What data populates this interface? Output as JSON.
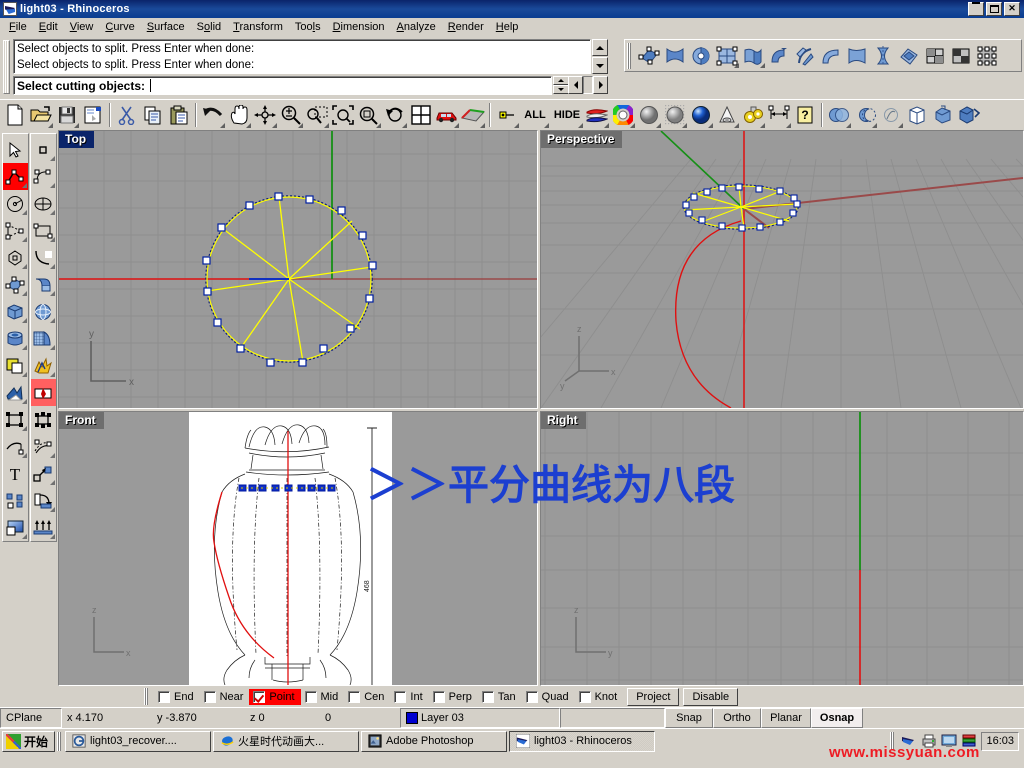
{
  "window": {
    "title": "light03 - Rhinoceros",
    "icon": "rhino-icon",
    "buttons": {
      "minimize": "_",
      "maximize": "❐",
      "close": "✕"
    }
  },
  "menu": {
    "items": [
      {
        "label": "File",
        "accel": "F"
      },
      {
        "label": "Edit",
        "accel": "E"
      },
      {
        "label": "View",
        "accel": "V"
      },
      {
        "label": "Curve",
        "accel": "C"
      },
      {
        "label": "Surface",
        "accel": "S"
      },
      {
        "label": "Solid",
        "accel": "o"
      },
      {
        "label": "Transform",
        "accel": "T"
      },
      {
        "label": "Tools",
        "accel": "l"
      },
      {
        "label": "Dimension",
        "accel": "D"
      },
      {
        "label": "Analyze",
        "accel": "A"
      },
      {
        "label": "Render",
        "accel": "R"
      },
      {
        "label": "Help",
        "accel": "H"
      }
    ]
  },
  "command": {
    "history": [
      "Select objects to split. Press Enter when done:",
      "Select objects to split. Press Enter when done:"
    ],
    "prompt_label": "Select cutting objects",
    "prompt_value": "",
    "prompt_placeholder": ""
  },
  "toolbars": {
    "standard": [
      {
        "name": "new-file-icon",
        "title": "New"
      },
      {
        "name": "open-file-icon",
        "title": "Open"
      },
      {
        "name": "save-icon",
        "title": "Save"
      },
      {
        "name": "print-icon",
        "title": "Print"
      },
      {
        "name": "cut-icon",
        "title": "Cut"
      },
      {
        "name": "copy-icon",
        "title": "Copy"
      },
      {
        "name": "paste-icon",
        "title": "Paste"
      },
      {
        "name": "undo-icon",
        "title": "Undo"
      },
      {
        "name": "pan-hand-icon",
        "title": "Pan"
      },
      {
        "name": "rotate-view-icon",
        "title": "Rotate view"
      },
      {
        "name": "zoom-in-out-icon",
        "title": "Zoom"
      },
      {
        "name": "zoom-window-icon",
        "title": "Zoom window"
      },
      {
        "name": "zoom-extents-icon",
        "title": "Zoom extents"
      },
      {
        "name": "zoom-selected-icon",
        "title": "Zoom selected"
      },
      {
        "name": "zoom-previous-icon",
        "title": "Zoom previous"
      },
      {
        "name": "four-view-icon",
        "title": "4 viewports"
      },
      {
        "name": "car-render-icon",
        "title": "Render"
      },
      {
        "name": "mesh-plane-icon",
        "title": "Shade"
      },
      {
        "name": "select-point-icon",
        "title": "Select"
      },
      {
        "name": "select-all-label",
        "title": "ALL",
        "text": "ALL"
      },
      {
        "name": "hide-label",
        "title": "HIDE",
        "text": "HIDE"
      },
      {
        "name": "layers-icon",
        "title": "Layers"
      },
      {
        "name": "color-wheel-icon",
        "title": "Color"
      },
      {
        "name": "shade-gray-icon",
        "title": "Shaded"
      },
      {
        "name": "render-mesh-icon",
        "title": "Render mesh"
      },
      {
        "name": "render-blue-icon",
        "title": "Render preview"
      },
      {
        "name": "spotlight-icon",
        "title": "Light"
      },
      {
        "name": "settings-gear-icon",
        "title": "Options"
      },
      {
        "name": "dimension-icon",
        "title": "Dimension"
      },
      {
        "name": "help-icon",
        "title": "Help"
      },
      {
        "name": "boolean-union-icon",
        "title": "Boolean union"
      },
      {
        "name": "boolean-difference-icon",
        "title": "Boolean difference"
      },
      {
        "name": "boolean-split-icon",
        "title": "Boolean split"
      },
      {
        "name": "cap-holes-icon",
        "title": "Cap holes"
      },
      {
        "name": "extrude-solid-icon",
        "title": "Extrude"
      },
      {
        "name": "box-edit-icon",
        "title": "Box edit"
      }
    ],
    "surface_tools": [
      {
        "name": "surface-from-points-icon",
        "title": "Surface from points"
      },
      {
        "name": "surface-from-curves-icon",
        "title": "Surface from curve network"
      },
      {
        "name": "revolve-surface-icon",
        "title": "Revolve"
      },
      {
        "name": "surface-grid-icon",
        "title": "Surface from grid"
      },
      {
        "name": "extrude-curve-icon",
        "title": "Extrude curve"
      },
      {
        "name": "sweep1-icon",
        "title": "Sweep 1 rail"
      },
      {
        "name": "sweep2-icon",
        "title": "Sweep 2 rails"
      },
      {
        "name": "loft-icon",
        "title": "Loft"
      },
      {
        "name": "rail-revolve-icon",
        "title": "Rail revolve"
      },
      {
        "name": "blend-surface-icon",
        "title": "Blend surface"
      },
      {
        "name": "patch-icon",
        "title": "Patch"
      },
      {
        "name": "surface-edit-1-icon",
        "title": "Surface edit"
      },
      {
        "name": "surface-edit-2-icon",
        "title": "Surface edit 2"
      },
      {
        "name": "control-points-icon",
        "title": "Control points"
      }
    ],
    "sidebar_left": [
      {
        "name": "select-arrow-icon",
        "title": "Select objects",
        "state": "normal"
      },
      {
        "name": "polyline-icon",
        "title": "Polyline",
        "state": "selected"
      },
      {
        "name": "circle-icon",
        "title": "Circle",
        "state": "normal"
      },
      {
        "name": "curve-point-icon",
        "title": "Curve from points",
        "state": "normal"
      },
      {
        "name": "polygon-icon",
        "title": "Polygon",
        "state": "normal"
      },
      {
        "name": "surface-patch-icon",
        "title": "Surface tools",
        "state": "normal"
      },
      {
        "name": "box-icon",
        "title": "Box",
        "state": "normal"
      },
      {
        "name": "cylinder-icon",
        "title": "Cylinder",
        "state": "normal"
      },
      {
        "name": "boolean-icon",
        "title": "Boolean",
        "state": "normal"
      },
      {
        "name": "fillet-edge-icon",
        "title": "Fillet edge",
        "state": "normal"
      },
      {
        "name": "group-objects-icon",
        "title": "Group",
        "state": "normal"
      },
      {
        "name": "offset-curve-icon",
        "title": "Offset curve",
        "state": "normal"
      },
      {
        "name": "text-tool-icon",
        "title": "Text",
        "state": "normal"
      },
      {
        "name": "points-array-icon",
        "title": "Points",
        "state": "normal"
      },
      {
        "name": "gradient-icon",
        "title": "Gradient / render",
        "state": "normal"
      }
    ],
    "sidebar_right": [
      {
        "name": "single-point-icon",
        "title": "Point",
        "state": "normal"
      },
      {
        "name": "control-point-curve-icon",
        "title": "Control point curve",
        "state": "normal"
      },
      {
        "name": "ellipse-icon",
        "title": "Ellipse",
        "state": "normal"
      },
      {
        "name": "rectangle-icon",
        "title": "Rectangle",
        "state": "normal"
      },
      {
        "name": "arc-icon",
        "title": "Arc",
        "state": "normal"
      },
      {
        "name": "extrude-surface-icon",
        "title": "Extrude surface",
        "state": "normal"
      },
      {
        "name": "sphere-icon",
        "title": "Sphere",
        "state": "normal"
      },
      {
        "name": "mesh-tools-icon",
        "title": "Mesh tools",
        "state": "normal"
      },
      {
        "name": "explode-icon",
        "title": "Explode",
        "state": "normal"
      },
      {
        "name": "split-icon",
        "title": "Split",
        "state": "selected2"
      },
      {
        "name": "transform-objects-icon",
        "title": "Transform",
        "state": "normal"
      },
      {
        "name": "rebuild-curve-icon",
        "title": "Rebuild curve",
        "state": "normal"
      },
      {
        "name": "scale-icon",
        "title": "Scale",
        "state": "normal"
      },
      {
        "name": "rotate-3d-icon",
        "title": "Rotate",
        "state": "normal"
      },
      {
        "name": "array-icon",
        "title": "Array",
        "state": "normal"
      }
    ]
  },
  "viewports": [
    {
      "name": "top-viewport",
      "label": "Top",
      "active": true,
      "axis_labels": [
        "y",
        "x"
      ]
    },
    {
      "name": "perspective-viewport",
      "label": "Perspective",
      "active": false,
      "axis_labels": [
        "z",
        "y",
        "x"
      ]
    },
    {
      "name": "front-viewport",
      "label": "Front",
      "active": false,
      "axis_labels": [
        "z",
        "x"
      ],
      "dimension_text": "468"
    },
    {
      "name": "right-viewport",
      "label": "Right",
      "active": false,
      "axis_labels": [
        "z",
        "y"
      ]
    }
  ],
  "annotation": {
    "text": "＞＞平分曲线为八段",
    "color": "#1c3fd0"
  },
  "osnap": {
    "items": [
      {
        "label": "End",
        "checked": false
      },
      {
        "label": "Near",
        "checked": false
      },
      {
        "label": "Point",
        "checked": true
      },
      {
        "label": "Mid",
        "checked": false
      },
      {
        "label": "Cen",
        "checked": false
      },
      {
        "label": "Int",
        "checked": false
      },
      {
        "label": "Perp",
        "checked": false
      },
      {
        "label": "Tan",
        "checked": false
      },
      {
        "label": "Quad",
        "checked": false
      },
      {
        "label": "Knot",
        "checked": false
      }
    ],
    "buttons": [
      {
        "label": "Project"
      },
      {
        "label": "Disable"
      }
    ]
  },
  "statusbar": {
    "cplane_label": "CPlane",
    "x": "x 4.170",
    "y": "y -3.870",
    "z": "z 0",
    "extra": "0",
    "layer_label": "Layer 03",
    "layer_color": "#0000d0",
    "toggles": [
      {
        "label": "Snap",
        "active": false
      },
      {
        "label": "Ortho",
        "active": false
      },
      {
        "label": "Planar",
        "active": false
      },
      {
        "label": "Osnap",
        "active": true
      }
    ]
  },
  "taskbar": {
    "start_label": "开始",
    "items": [
      {
        "label": "light03_recover....",
        "icon": "winrar-icon",
        "active": false
      },
      {
        "label": "火星时代动画大...",
        "icon": "ie-icon",
        "active": false
      },
      {
        "label": "Adobe Photoshop",
        "icon": "photoshop-icon",
        "active": false
      },
      {
        "label": "light03 - Rhinoceros",
        "icon": "rhino-icon",
        "active": true
      }
    ],
    "tray": [
      {
        "name": "rhino-tray-icon"
      },
      {
        "name": "printer-tray-icon"
      },
      {
        "name": "monitor-tray-icon"
      },
      {
        "name": "books-tray-icon"
      }
    ],
    "clock": "16:03"
  },
  "watermark": {
    "text": "www.missyuan.com"
  }
}
